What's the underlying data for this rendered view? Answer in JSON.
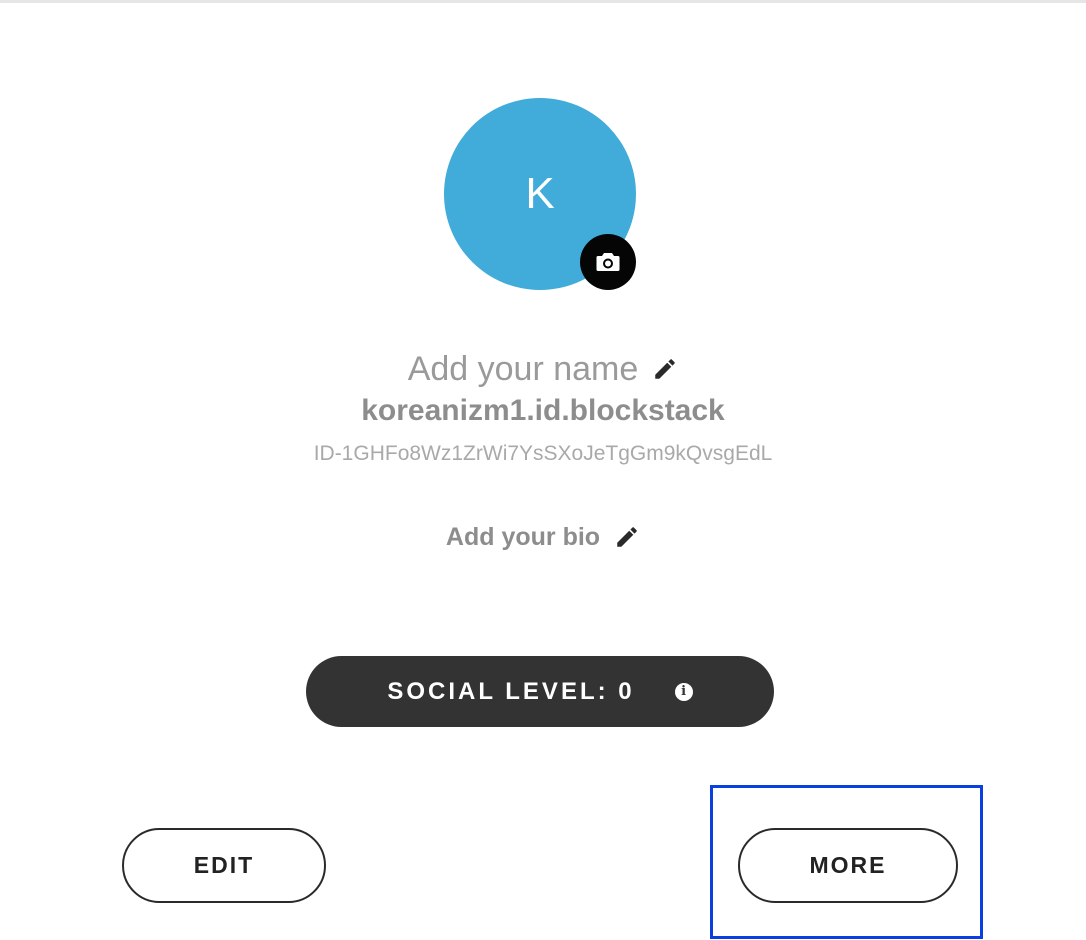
{
  "profile": {
    "avatar_initial": "K",
    "avatar_color": "#41acd9",
    "camera_icon": "camera-icon",
    "name_placeholder": "Add your name",
    "username": "koreanizm1.id.blockstack",
    "user_id": "ID-1GHFo8Wz1ZrWi7YsSXoJeTgGm9kQvsgEdL",
    "bio_placeholder": "Add your bio",
    "edit_icon": "pencil-icon"
  },
  "social": {
    "label": "SOCIAL LEVEL: 0",
    "info_icon": "info-icon",
    "info_glyph": "i"
  },
  "actions": {
    "edit_label": "EDIT",
    "more_label": "MORE"
  },
  "highlight": {
    "target": "MORE",
    "color": "#0a3fe0"
  }
}
